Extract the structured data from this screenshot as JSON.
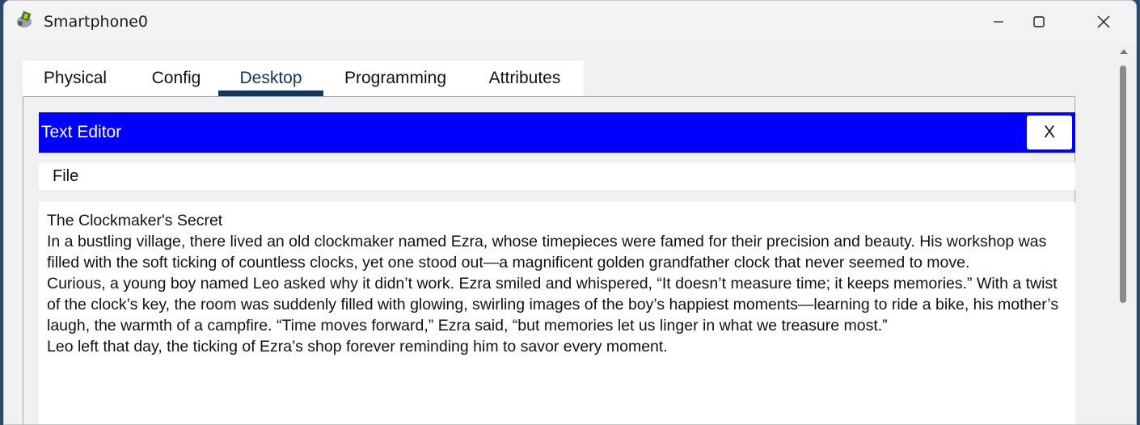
{
  "window": {
    "title": "Smartphone0"
  },
  "tabs": [
    {
      "label": "Physical"
    },
    {
      "label": "Config"
    },
    {
      "label": "Desktop"
    },
    {
      "label": "Programming"
    },
    {
      "label": "Attributes"
    }
  ],
  "active_tab": "Desktop",
  "editor": {
    "title": "Text Editor",
    "close_label": "X",
    "menu": {
      "file_label": "File"
    },
    "lines": [
      "The Clockmaker's Secret",
      "In a bustling village, there lived an old clockmaker named Ezra, whose timepieces were famed for their precision and beauty. His workshop was filled with the soft ticking of countless clocks, yet one stood out—a magnificent golden grandfather clock that never seemed to move.",
      "Curious, a young boy named Leo asked why it didn’t work. Ezra smiled and whispered, “It doesn’t measure time; it keeps memories.” With a twist of the clock’s key, the room was suddenly filled with glowing, swirling images of the boy’s happiest moments—learning to ride a bike, his mother’s laugh, the warmth of a campfire. “Time moves forward,” Ezra said, “but memories let us linger in what we treasure most.”",
      "Leo left that day, the ticking of Ezra’s shop forever reminding him to savor every moment."
    ]
  },
  "colors": {
    "header_bg": "#0000ff",
    "active_tab_underline": "#17345a"
  }
}
